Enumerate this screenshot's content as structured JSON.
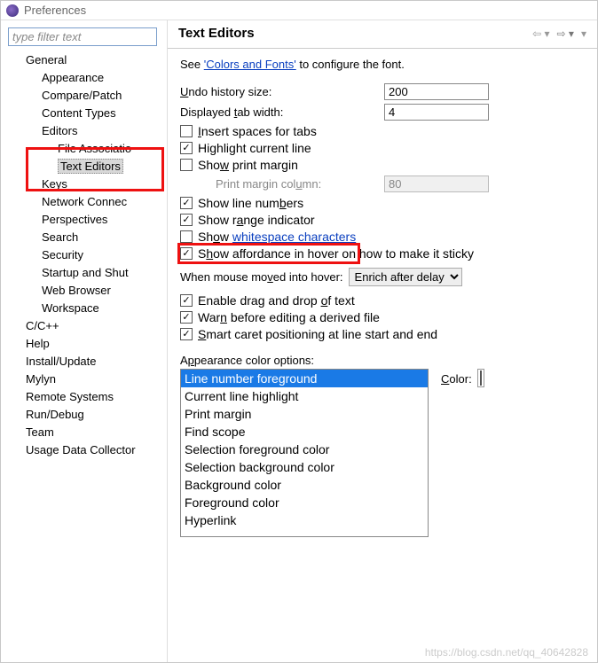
{
  "window": {
    "title": "Preferences"
  },
  "sidebar": {
    "filter_placeholder": "type filter text",
    "items": [
      {
        "label": "General",
        "level": 0
      },
      {
        "label": "Appearance",
        "level": 1
      },
      {
        "label": "Compare/Patch",
        "level": 1
      },
      {
        "label": "Content Types",
        "level": 1
      },
      {
        "label": "Editors",
        "level": 1
      },
      {
        "label": "File Associatio",
        "level": 2
      },
      {
        "label": "Text Editors",
        "level": 2,
        "selected": true
      },
      {
        "label": "Keys",
        "level": 1
      },
      {
        "label": "Network Connec",
        "level": 1
      },
      {
        "label": "Perspectives",
        "level": 1
      },
      {
        "label": "Search",
        "level": 1
      },
      {
        "label": "Security",
        "level": 1
      },
      {
        "label": "Startup and Shut",
        "level": 1
      },
      {
        "label": "Web Browser",
        "level": 1
      },
      {
        "label": "Workspace",
        "level": 1
      },
      {
        "label": "C/C++",
        "level": 0
      },
      {
        "label": "Help",
        "level": 0
      },
      {
        "label": "Install/Update",
        "level": 0
      },
      {
        "label": "Mylyn",
        "level": 0
      },
      {
        "label": "Remote Systems",
        "level": 0
      },
      {
        "label": "Run/Debug",
        "level": 0
      },
      {
        "label": "Team",
        "level": 0
      },
      {
        "label": "Usage Data Collector",
        "level": 0
      }
    ]
  },
  "header": {
    "title": "Text Editors"
  },
  "hint": {
    "prefix": "See ",
    "link": "'Colors and Fonts'",
    "suffix": " to configure the font."
  },
  "fields": {
    "undo_label": "Undo history size:",
    "undo_value": "200",
    "tab_label": "Displayed tab width:",
    "tab_value": "4",
    "print_col_label": "Print margin column:",
    "print_col_value": "80"
  },
  "checks": {
    "insert_spaces": "Insert spaces for tabs",
    "highlight_line": "Highlight current line",
    "show_print_margin": "Show print margin",
    "show_line_numbers": "Show line numbers",
    "show_range": "Show range indicator",
    "show_whitespace_pre": "Show ",
    "show_whitespace_link": "whitespace characters",
    "show_affordance": "Show affordance in hover on how to make it sticky"
  },
  "hover": {
    "label": "When mouse moved into hover:",
    "selected": "Enrich after delay",
    "options": [
      "Enrich after delay"
    ]
  },
  "checks2": {
    "drag_drop": "Enable drag and drop of text",
    "warn_derived": "Warn before editing a derived file",
    "smart_caret": "Smart caret positioning at line start and end"
  },
  "appearance": {
    "title": "Appearance color options:",
    "options": [
      "Line number foreground",
      "Current line highlight",
      "Print margin",
      "Find scope",
      "Selection foreground color",
      "Selection background color",
      "Background color",
      "Foreground color",
      "Hyperlink"
    ],
    "selected_index": 0,
    "color_label": "Color:",
    "color_value": "#7a7a7a"
  },
  "watermark": "https://blog.csdn.net/qq_40642828"
}
